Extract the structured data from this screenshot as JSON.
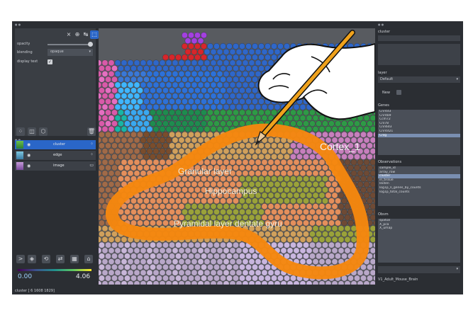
{
  "left_panel": {
    "controls": {
      "opacity_label": "opacity",
      "blending_label": "blending",
      "blending_value": "opaque",
      "display_text_label": "display text"
    },
    "layers": [
      {
        "name": "cluster",
        "selected": true,
        "color": "#2e7d32"
      },
      {
        "name": "edge",
        "selected": false,
        "color": "#3a7ca5"
      },
      {
        "name": "image",
        "selected": false,
        "color": "#7b4a9e"
      }
    ],
    "colorbar": {
      "min_label": "0.00",
      "max_label": "4.06"
    },
    "status": "cluster [ 6 1608 1829]"
  },
  "canvas": {
    "region_labels": {
      "cortex": "Cortex_1",
      "granular": "Granular layer",
      "hippocampus": "Hippocampus",
      "pyramidal": "Pyramidal layer dentate gyru"
    },
    "annotation_color": "#f5870e"
  },
  "right_panel": {
    "title_label": "cluster",
    "layer_label": "layer",
    "layer_value": "Default",
    "new_label": "New",
    "genes_label": "Genes",
    "genes": [
      "Cnr4d3",
      "Cnr4b9",
      "Ccm72",
      "Cnl78",
      "Cnn6d3",
      "Cnr4d21",
      "Cnlg"
    ],
    "genes_highlight": 6,
    "obs_label": "Observations",
    "observations": [
      "sample_id",
      "array_row",
      "cluster",
      "in_tissue",
      "leiden",
      "log1p_n_genes_by_counts",
      "log1p_total_counts"
    ],
    "obs_highlight": 2,
    "obsm_label": "Obsm",
    "obsm": [
      "spatial",
      "X_pca",
      "X_umap"
    ],
    "footer": "V1_Adult_Mouse_Brain"
  }
}
